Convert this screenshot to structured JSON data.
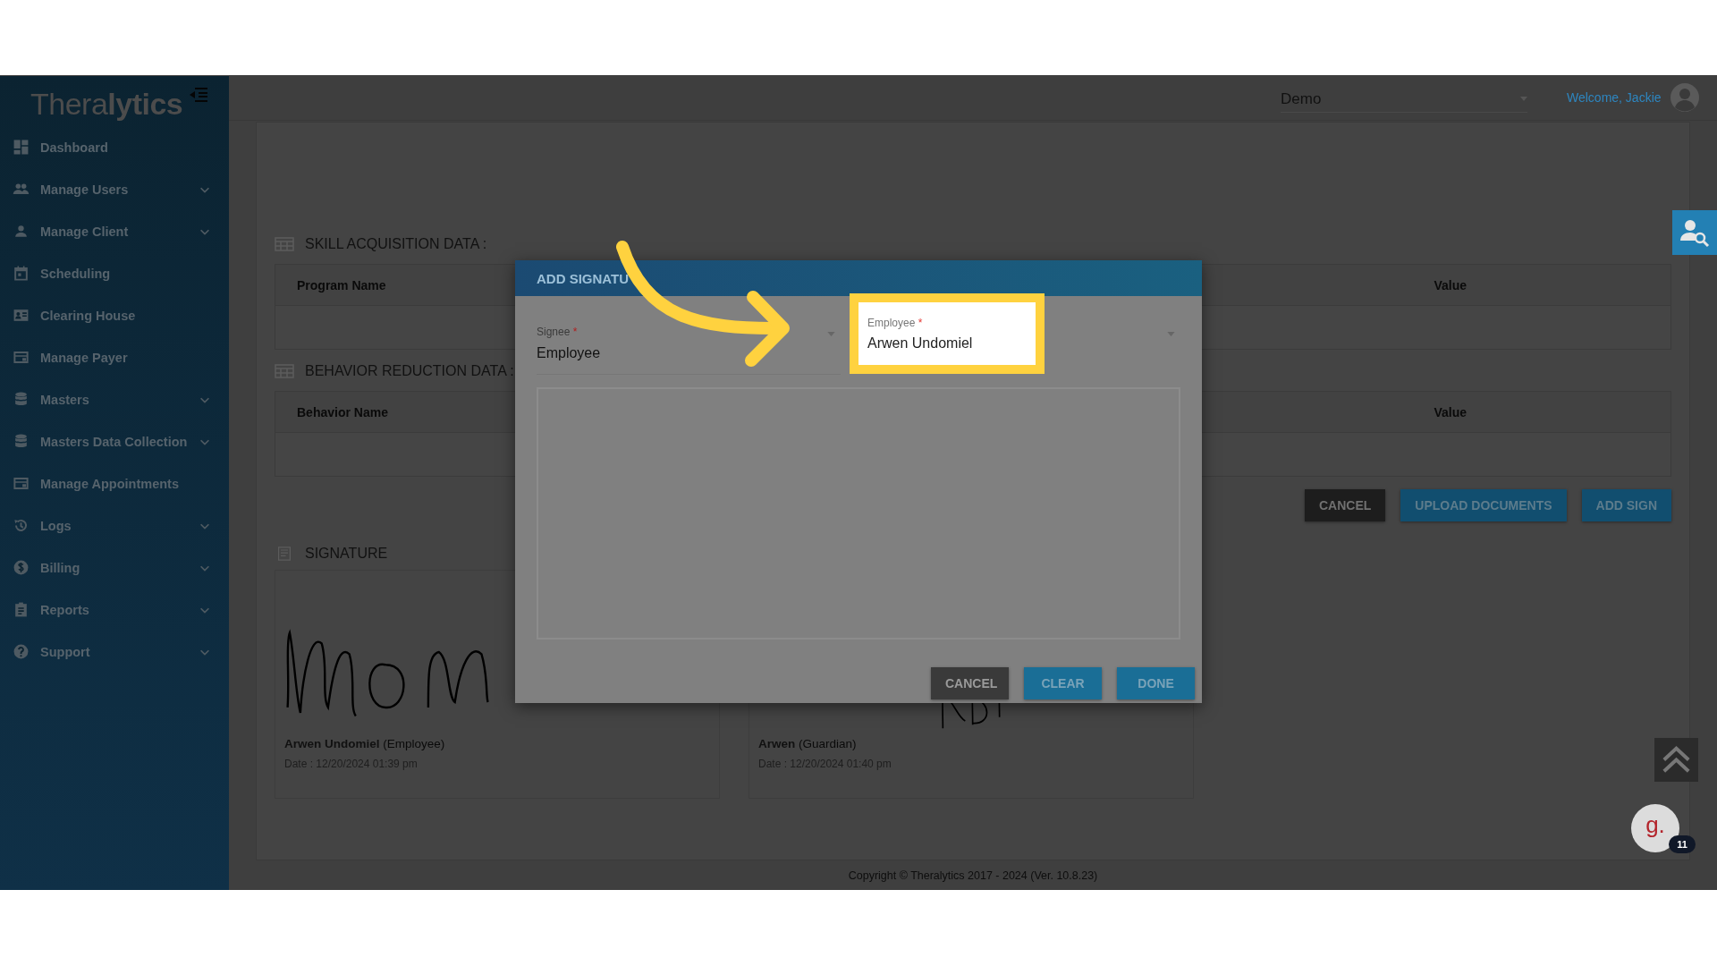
{
  "logo": {
    "text": "Thera**lytics**"
  },
  "sidebar": {
    "items": [
      {
        "label": "Dashboard",
        "expandable": false
      },
      {
        "label": "Manage Users",
        "expandable": true
      },
      {
        "label": "Manage Client",
        "expandable": true
      },
      {
        "label": "Scheduling",
        "expandable": false
      },
      {
        "label": "Clearing House",
        "expandable": false
      },
      {
        "label": "Manage Payer",
        "expandable": false
      },
      {
        "label": "Masters",
        "expandable": true
      },
      {
        "label": "Masters Data Collection",
        "expandable": true
      },
      {
        "label": "Manage Appointments",
        "expandable": false
      },
      {
        "label": "Logs",
        "expandable": true
      },
      {
        "label": "Billing",
        "expandable": true
      },
      {
        "label": "Reports",
        "expandable": true
      },
      {
        "label": "Support",
        "expandable": true
      }
    ]
  },
  "header": {
    "location": "Demo",
    "welcome": "Welcome, Jackie"
  },
  "sections": [
    {
      "title": "SKILL ACQUISITION DATA :",
      "columns": [
        "Program Name",
        "Value"
      ]
    },
    {
      "title": "BEHAVIOR REDUCTION DATA :",
      "columns": [
        "Behavior Name",
        "Value"
      ]
    }
  ],
  "actions": [
    {
      "label": "CANCEL",
      "kind": "dark"
    },
    {
      "label": "UPLOAD DOCUMENTS",
      "kind": "primary"
    },
    {
      "label": "ADD SIGN",
      "kind": "primary"
    }
  ],
  "signatures": {
    "title": "SIGNATURE",
    "cards": [
      {
        "name": "Arwen Undomiel",
        "role": "(Employee)",
        "date": "Date : 12/20/2024 01:39 pm"
      },
      {
        "name": "Arwen",
        "role": "(Guardian)",
        "date": "Date : 12/20/2024 01:40 pm"
      }
    ]
  },
  "footer": "Copyright © Theralytics 2017 - 2024 (Ver. 10.8.23)",
  "modal": {
    "title": "ADD SIGNATU",
    "fields": [
      {
        "label": "Signee",
        "required_mark": "*",
        "value": "Employee",
        "highlighted": false
      },
      {
        "label": "Employee",
        "required_mark": "*",
        "value": "Arwen Undomiel",
        "highlighted": true
      }
    ],
    "buttons": [
      {
        "label": "CANCEL",
        "kind": "dark"
      },
      {
        "label": "CLEAR",
        "kind": "primary"
      },
      {
        "label": "DONE",
        "kind": "primary"
      }
    ]
  },
  "chat": {
    "logo": "g.",
    "count": "11"
  }
}
